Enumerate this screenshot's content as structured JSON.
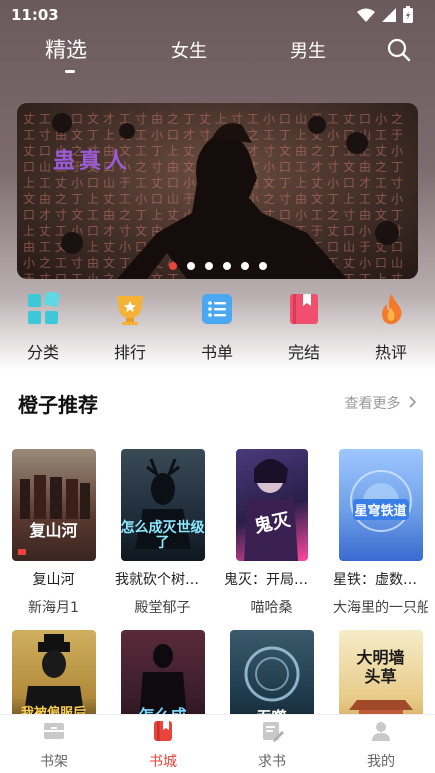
{
  "status_bar": {
    "time": "11:03"
  },
  "top_tabs": [
    {
      "label": "精选",
      "active": true
    },
    {
      "label": "女生",
      "active": false
    },
    {
      "label": "男生",
      "active": false
    }
  ],
  "banner": {
    "title": "蛊真人",
    "glyphs": "丈工小口文才工寸由之丁丈上寸工小口山于工丈口小之工寸由文丁上丈工小口才寸文由之工丁上丈小口山工于丈口小之寸由文工丁上丈小工口才寸文由之丁工上丈小口山工于丈口小之寸由文丁工上丈小口工才寸文由之丁上工丈小口山于工丈口小之寸工由文丁上丈小口才工寸文由之丁上丈工小口山于丈工口小之寸由文丁上工丈小口才寸文工由之丁上丈小口工山于丈口小工之寸由文丁上丈工小口才寸文由工之丁上丈小口山工于丈口小之寸由工文丁上丈小口才寸工文由之丁上丈小工口山于丈口小之工寸由文丁上丈小口工才寸文由之丁上工丈小口山于丈口工小之寸由文丁上丈工小口才寸文由之工丁上丈小口山于工丈口小之寸由文丁工上丈小口才寸文工由之丁上丈小口山工于丈口小之寸由文工",
    "dot_count": 6,
    "active_dot": 0
  },
  "categories": [
    {
      "label": "分类",
      "icon": "grid-icon",
      "color": "#3cc8d8"
    },
    {
      "label": "排行",
      "icon": "trophy-icon",
      "color": "#f5b335"
    },
    {
      "label": "书单",
      "icon": "list-icon",
      "color": "#4aa8f0"
    },
    {
      "label": "完结",
      "icon": "bookmark-book-icon",
      "color": "#f0506e"
    },
    {
      "label": "热评",
      "icon": "flame-icon",
      "color": "#f37a2a"
    }
  ],
  "section": {
    "title": "橙子推荐",
    "more": "查看更多"
  },
  "books_row1": [
    {
      "title": "复山河",
      "author": "新海月1",
      "cover_text": "复山河",
      "cover_bg": "#5a3a30"
    },
    {
      "title": "我就砍个树，…",
      "author": "殿堂郁子",
      "cover_text": "怎么成灭世级了",
      "cover_bg": "#1f2d3a"
    },
    {
      "title": "鬼灭：开局被…",
      "author": "喵哈桑",
      "cover_text": "鬼灭",
      "cover_bg": "#2a1f4a"
    },
    {
      "title": "星铁：虚数？…",
      "author": "大海里的一只船",
      "cover_text": "星穹铁道",
      "cover_bg": "#6ea0e8"
    }
  ],
  "books_row2": [
    {
      "cover_text": "我被偏服后",
      "cover_bg": "#b08a3a"
    },
    {
      "cover_text": "怎么成",
      "cover_bg": "#3a1e2a"
    },
    {
      "cover_text": "吞噬",
      "cover_bg": "#1e3a4a"
    },
    {
      "cover_text": "大明墙头草",
      "cover_bg": "#e8cc8a"
    }
  ],
  "bottom_nav": [
    {
      "label": "书架",
      "active": false
    },
    {
      "label": "书城",
      "active": true
    },
    {
      "label": "求书",
      "active": false
    },
    {
      "label": "我的",
      "active": false
    }
  ],
  "colors": {
    "accent": "#e8453c",
    "muted": "#999999"
  }
}
